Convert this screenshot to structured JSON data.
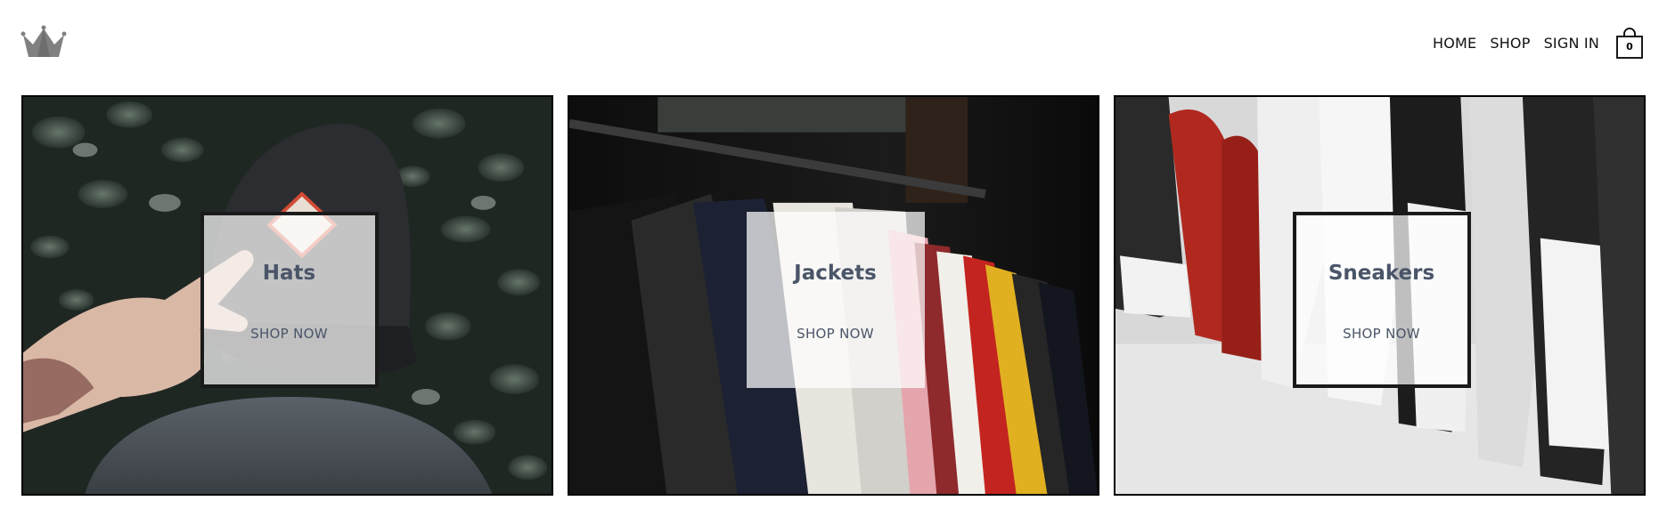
{
  "header": {
    "logo": {
      "icon": "crown-icon"
    },
    "nav": {
      "home_label": "HOME",
      "shop_label": "SHOP",
      "sign_in_label": "SIGN IN"
    },
    "cart": {
      "icon": "shopping-bag-icon",
      "count": "0"
    }
  },
  "categories": [
    {
      "title": "Hats",
      "cta": "SHOP NOW"
    },
    {
      "title": "Jackets",
      "cta": "SHOP NOW"
    },
    {
      "title": "Sneakers",
      "cta": "SHOP NOW"
    }
  ],
  "colors": {
    "text_dark": "#111111",
    "label_text": "#4a5568",
    "tile_border": "#000000"
  }
}
